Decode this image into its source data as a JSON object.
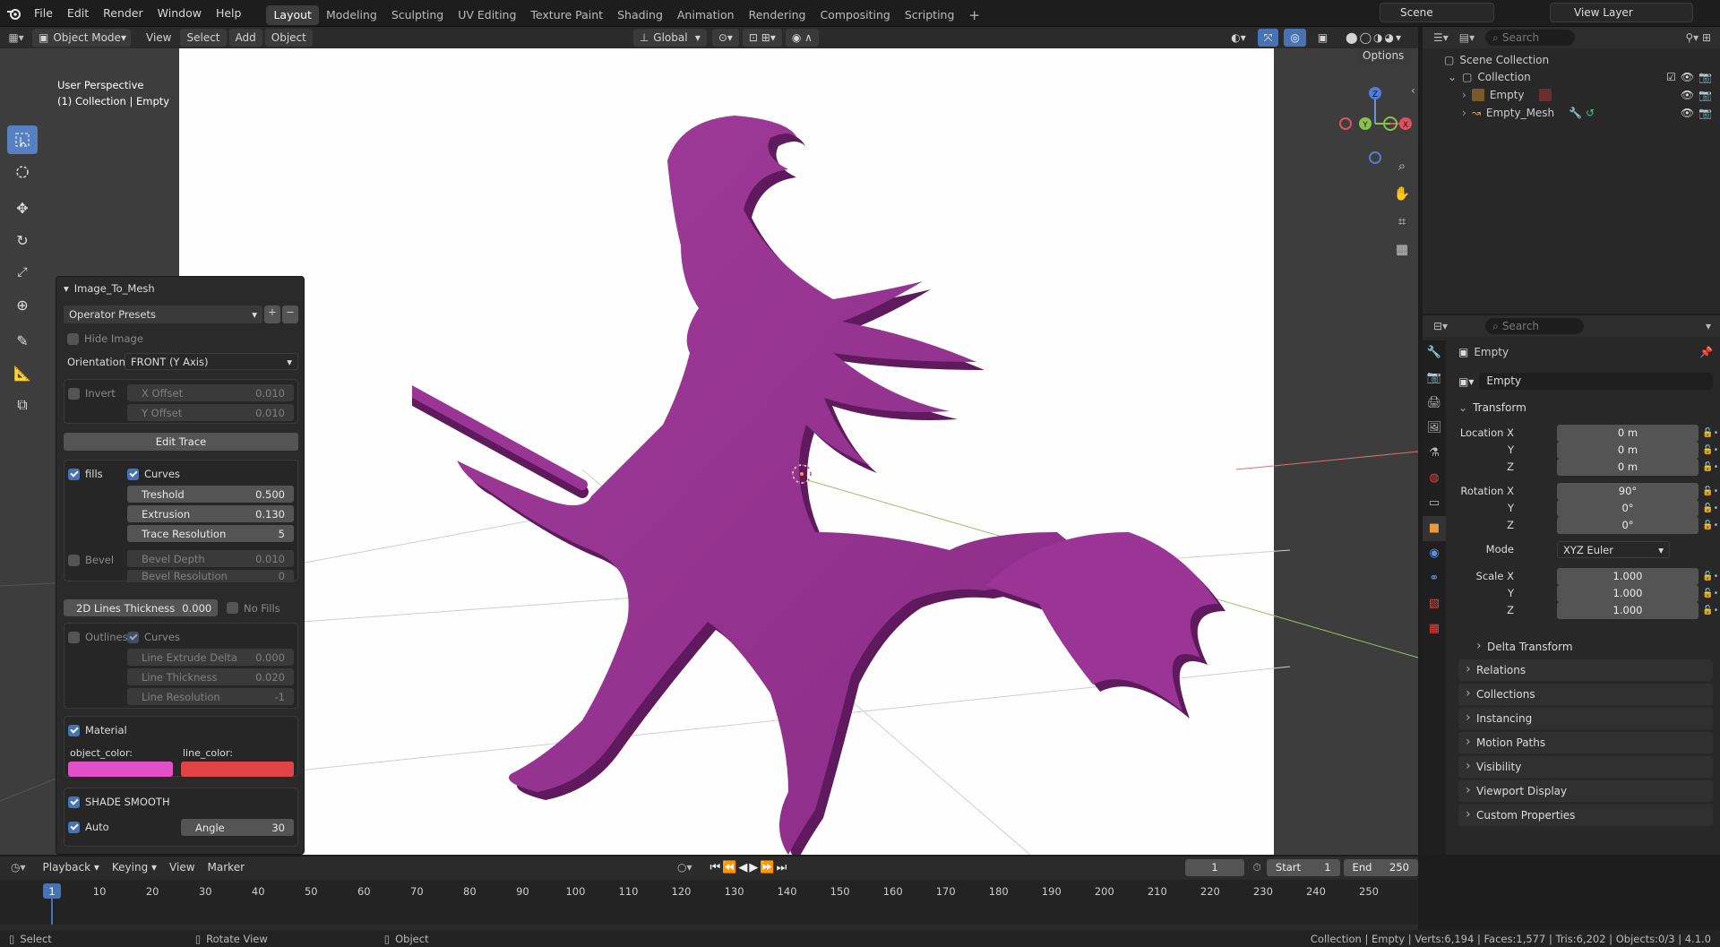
{
  "top_menu": [
    "File",
    "Edit",
    "Render",
    "Window",
    "Help"
  ],
  "workspace_tabs": [
    "Layout",
    "Modeling",
    "Sculpting",
    "UV Editing",
    "Texture Paint",
    "Shading",
    "Animation",
    "Rendering",
    "Compositing",
    "Scripting"
  ],
  "active_tab": "Layout",
  "scene_name": "Scene",
  "view_layer": "View Layer",
  "viewport_header": {
    "mode": "Object Mode",
    "menus": [
      "View",
      "Select",
      "Add",
      "Object"
    ],
    "transform_orientation": "Global",
    "options": "Options"
  },
  "viewport_overlay": {
    "line1": "User Perspective",
    "line2": "(1) Collection | Empty"
  },
  "gizmo": {
    "x": "X",
    "y": "Y",
    "z": "Z"
  },
  "operator": {
    "title": "Image_To_Mesh",
    "presets": "Operator Presets",
    "hide_image": "Hide Image",
    "orientation_label": "Orientation:",
    "orientation_value": "FRONT (Y Axis)",
    "invert": "Invert",
    "x_offset_label": "X Offset",
    "x_offset": "0.010",
    "y_offset_label": "Y Offset",
    "y_offset": "0.010",
    "edit_trace": "Edit Trace",
    "fills": "fills",
    "curves": "Curves",
    "treshold_label": "Treshold",
    "treshold": "0.500",
    "extrusion_label": "Extrusion",
    "extrusion": "0.130",
    "trace_res_label": "Trace Resolution",
    "trace_res": "5",
    "bevel": "Bevel",
    "bevel_depth_label": "Bevel Depth",
    "bevel_depth": "0.010",
    "bevel_res_label": "Bevel Resolution",
    "bevel_res": "0",
    "lines2d_label": "2D Lines Thickness",
    "lines2d": "0.000",
    "no_fills": "No Fills",
    "outlines": "Outlines",
    "curves2": "Curves",
    "line_extrude_label": "Line Extrude Delta",
    "line_extrude": "0.000",
    "line_thick_label": "Line Thickness",
    "line_thick": "0.020",
    "line_res_label": "Line Resolution",
    "line_res": "-1",
    "material": "Material",
    "object_color_label": "object_color:",
    "line_color_label": "line_color:",
    "object_color": "#e14fc9",
    "line_color": "#e04444",
    "shade_smooth": "SHADE SMOOTH",
    "auto": "Auto",
    "angle_label": "Angle",
    "angle": "30"
  },
  "outliner": {
    "search_placeholder": "Search",
    "scene_collection": "Scene Collection",
    "collection": "Collection",
    "items": [
      "Empty",
      "Empty_Mesh"
    ]
  },
  "properties": {
    "search_placeholder": "Search",
    "object_name": "Empty",
    "data_name": "Empty",
    "transform": "Transform",
    "location_label": "Location X",
    "y": "Y",
    "z": "Z",
    "location": [
      "0 m",
      "0 m",
      "0 m"
    ],
    "rotation_label": "Rotation X",
    "rotation": [
      "90°",
      "0°",
      "0°"
    ],
    "mode_label": "Mode",
    "mode": "XYZ Euler",
    "scale_label": "Scale X",
    "scale": [
      "1.000",
      "1.000",
      "1.000"
    ],
    "delta": "Delta Transform",
    "panels": [
      "Relations",
      "Collections",
      "Instancing",
      "Motion Paths",
      "Visibility",
      "Viewport Display",
      "Custom Properties"
    ]
  },
  "timeline": {
    "menus": [
      "Playback",
      "Keying",
      "View",
      "Marker"
    ],
    "current_frame": "1",
    "start_label": "Start",
    "start": "1",
    "end_label": "End",
    "end": "250",
    "frame_numbers": [
      "1",
      "10",
      "20",
      "30",
      "40",
      "50",
      "60",
      "70",
      "80",
      "90",
      "100",
      "110",
      "120",
      "130",
      "140",
      "150",
      "160",
      "170",
      "180",
      "190",
      "200",
      "210",
      "220",
      "230",
      "240",
      "250"
    ]
  },
  "statusbar": {
    "select": "Select",
    "rotate": "Rotate View",
    "object": "Object",
    "stats": "Collection | Empty | Verts:6,194 | Faces:1,577 | Tris:6,202 | Objects:0/3 | 4.1.0"
  }
}
